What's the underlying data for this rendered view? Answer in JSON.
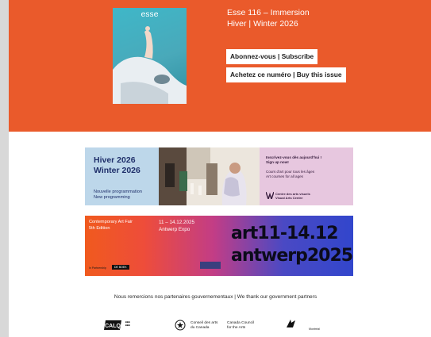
{
  "hero": {
    "cover_wordmark": "esse",
    "issue_title": "Esse 116 – Immersion",
    "issue_season": "Hiver | Winter 2026",
    "subscribe_label": "Abonnez-vous | Subscribe",
    "buy_label": "Achetez ce numéro | Buy this issue"
  },
  "banner1": {
    "heading_line1": "Hiver 2026",
    "heading_line2": "Winter 2026",
    "sub_line1": "Nouvelle programmation",
    "sub_line2": "New programming",
    "right_line1": "Inscrivez-vous dès aujourd'hui !",
    "right_line2": "Sign up now!",
    "right_line3": "Cours d'art pour tous les âges",
    "right_line4": "Art courses for all ages",
    "logo_line1": "Centre des arts visuels",
    "logo_line2": "Visual Arts Centre"
  },
  "banner2": {
    "fair_line1": "Contemporary Art Fair",
    "fair_line2": "5th Edition",
    "dates": "11 – 14.12.2025",
    "venue": "Antwerp Expo",
    "big_line1": "art11-14.12",
    "big_line2": "antwerp2025",
    "sponsor_label": "In Partnership",
    "sponsor_name": "DE BOEK"
  },
  "partners": {
    "thanks_text": "Nous remercions nos partenaires gouvernementaux | We thank our government partners",
    "calq_name": "CALQ",
    "cac_fr_1": "Conseil des arts",
    "cac_fr_2": "du Canada",
    "cac_en_1": "Canada Council",
    "cac_en_2": "for the Arts",
    "mtl_name": "Montréal"
  },
  "colors": {
    "hero_bg": "#ea5a2b",
    "banner1_left": "#bdd7ea",
    "banner1_right": "#e7c7df"
  }
}
